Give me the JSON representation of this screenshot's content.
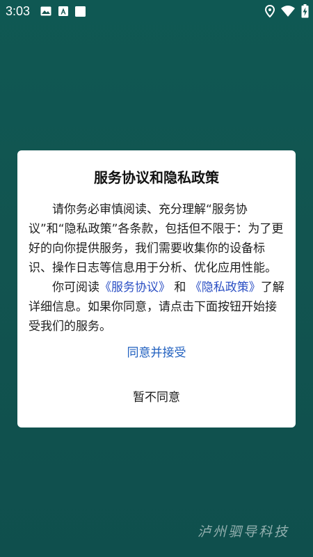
{
  "status_bar": {
    "time": "3:03",
    "left_icons": [
      "image-icon",
      "a-square-icon",
      "white-square-icon"
    ],
    "right_icons": [
      "location-icon",
      "wifi-icon",
      "battery-charging-icon"
    ]
  },
  "dialog": {
    "title": "服务协议和隐私政策",
    "paragraph1": "请你务必审慎阅读、充分理解“服务协议”和“隐私政策”各条款，包括但不限于：为了更好的向你提供服务，我们需要收集你的设备标识、操作日志等信息用于分析、优化应用性能。",
    "paragraph2_prefix": "你可阅读",
    "service_agreement_link": "《服务协议》",
    "paragraph2_and": " 和 ",
    "privacy_policy_link": "《隐私政策》",
    "paragraph2_suffix": "了解详细信息。如果你同意，请点击下面按钮开始接受我们的服务。",
    "accept_label": "同意并接受",
    "decline_label": "暂不同意"
  },
  "watermark": "泸州驷导科技",
  "colors": {
    "background": "#125450",
    "link": "#2b4fc4",
    "accept": "#1f5fbf"
  }
}
